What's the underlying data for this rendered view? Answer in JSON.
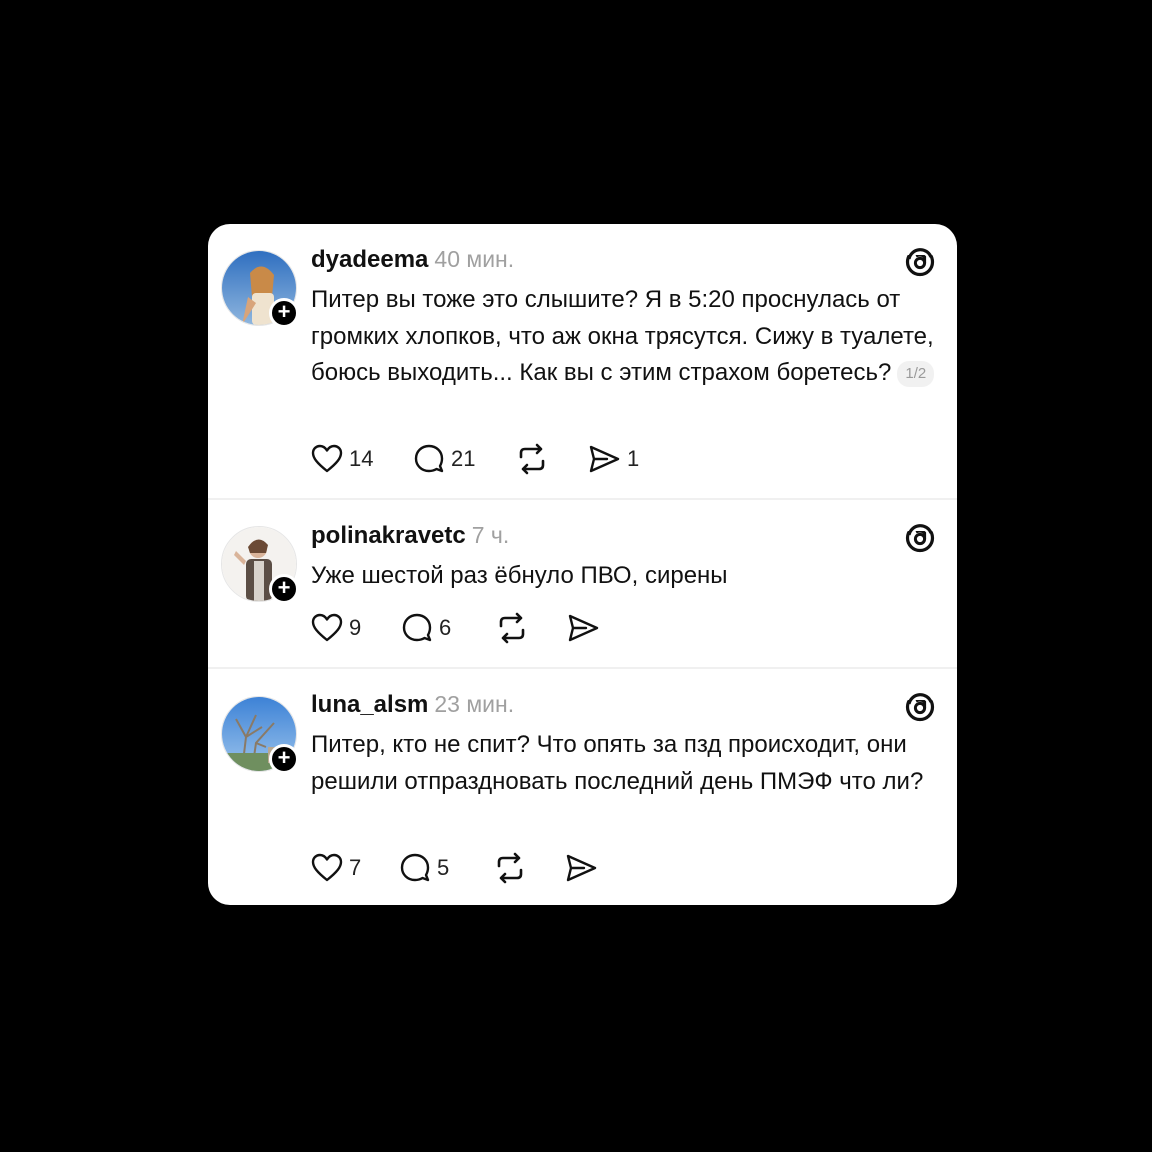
{
  "posts": [
    {
      "username": "dyadeema",
      "time": "40 мин.",
      "text": "Питер вы тоже это слышите? Я в 5:20 проснулась от громких хлопков, что аж окна трясутся. Сижу в туалете, боюсь выходить... Как вы с этим страхом боретесь?",
      "pager": "1/2",
      "likes": "14",
      "comments": "21",
      "reposts": "",
      "shares": "1",
      "avatar_icon": "profile-photo"
    },
    {
      "username": "polinakravetc",
      "time": "7 ч.",
      "text": "Уже шестой раз ёбнуло ПВО, сирены",
      "likes": "9",
      "comments": "6",
      "reposts": "",
      "shares": "",
      "avatar_icon": "profile-photo"
    },
    {
      "username": "luna_alsm",
      "time": "23 мин.",
      "text": "Питер, кто не спит? Что опять за пзд происходит, они решили отпраздновать последний день ПМЭФ что ли?",
      "likes": "7",
      "comments": "5",
      "reposts": "",
      "shares": "",
      "avatar_icon": "profile-photo"
    }
  ],
  "icons": {
    "like": "heart-icon",
    "comment": "speech-bubble-icon",
    "repost": "repost-arrows-icon",
    "share": "paper-plane-icon",
    "brand": "threads-logo-icon",
    "follow": "plus-icon"
  },
  "colors": {
    "background": "#000000",
    "card": "#ffffff",
    "text": "#111111",
    "muted": "#a0a0a0"
  }
}
